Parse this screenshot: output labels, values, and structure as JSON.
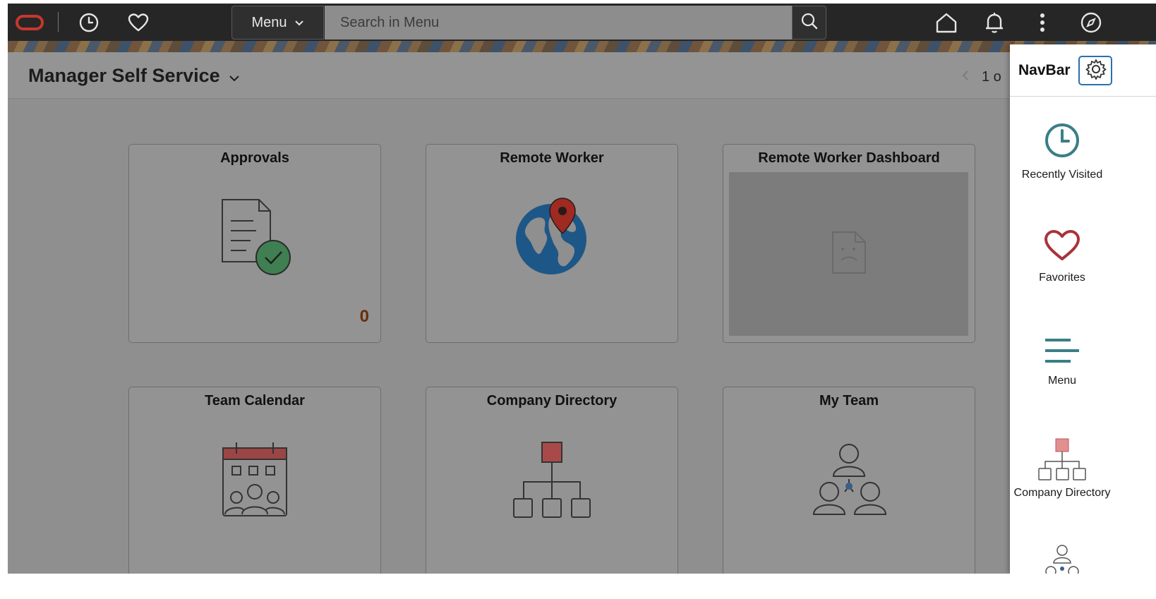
{
  "topbar": {
    "menu_label": "Menu",
    "search_placeholder": "Search in Menu",
    "icons": [
      "oracle-logo",
      "clock-icon",
      "heart-icon",
      "chevron-down-icon",
      "search-icon",
      "home-icon",
      "bell-icon",
      "more-vertical-icon",
      "compass-icon"
    ]
  },
  "header": {
    "title": "Manager Self Service",
    "pager": "1 o"
  },
  "tiles": [
    {
      "title": "Approvals",
      "count": "0"
    },
    {
      "title": "Remote Worker"
    },
    {
      "title": "Remote Worker Dashboard"
    },
    {
      "title": "Team Calendar"
    },
    {
      "title": "Company Directory"
    },
    {
      "title": "My Team"
    }
  ],
  "navbar": {
    "title": "NavBar",
    "items": [
      {
        "label": "Recently Visited"
      },
      {
        "label": "Favorites"
      },
      {
        "label": "Menu"
      },
      {
        "label": "Company Directory"
      },
      {
        "label": ""
      }
    ]
  },
  "colors": {
    "accent_blue": "#2a6fb0",
    "nav_teal": "#3a7e86",
    "favorite_red": "#a8333b",
    "overlay_gray": "#8f8f8f"
  }
}
